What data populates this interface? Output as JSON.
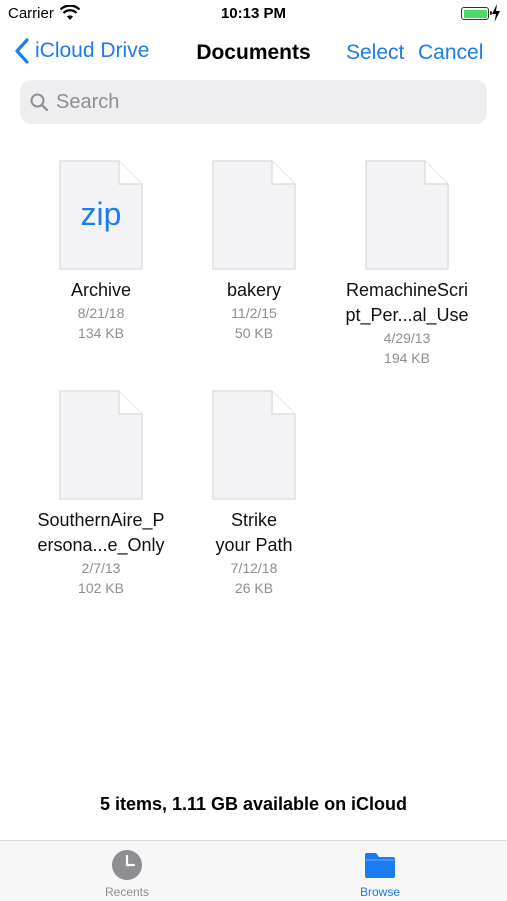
{
  "status": {
    "carrier": "Carrier",
    "time": "10:13 PM"
  },
  "nav": {
    "back_label": "iCloud Drive",
    "title": "Documents",
    "select_label": "Select",
    "cancel_label": "Cancel"
  },
  "search": {
    "placeholder": "Search"
  },
  "files": [
    {
      "name_lines": [
        "Archive"
      ],
      "date": "8/21/18",
      "size": "134 KB",
      "badge": "zip"
    },
    {
      "name_lines": [
        "bakery"
      ],
      "date": "11/2/15",
      "size": "50 KB"
    },
    {
      "name_lines": [
        "RemachineScri",
        "pt_Per...al_Use"
      ],
      "date": "4/29/13",
      "size": "194 KB"
    },
    {
      "name_lines": [
        "SouthernAire_P",
        "ersona...e_Only"
      ],
      "date": "2/7/13",
      "size": "102 KB"
    },
    {
      "name_lines": [
        "Strike",
        "your Path"
      ],
      "date": "7/12/18",
      "size": "26 KB"
    }
  ],
  "footer": {
    "summary": "5 items, 1.11 GB available on iCloud"
  },
  "tabs": [
    {
      "label": "Recents",
      "icon": "clock-icon",
      "active": false
    },
    {
      "label": "Browse",
      "icon": "folder-icon",
      "active": true
    }
  ],
  "colors": {
    "accent": "#1a7cf0",
    "battery": "#4cd964",
    "secondary_text": "#8e8e93"
  }
}
